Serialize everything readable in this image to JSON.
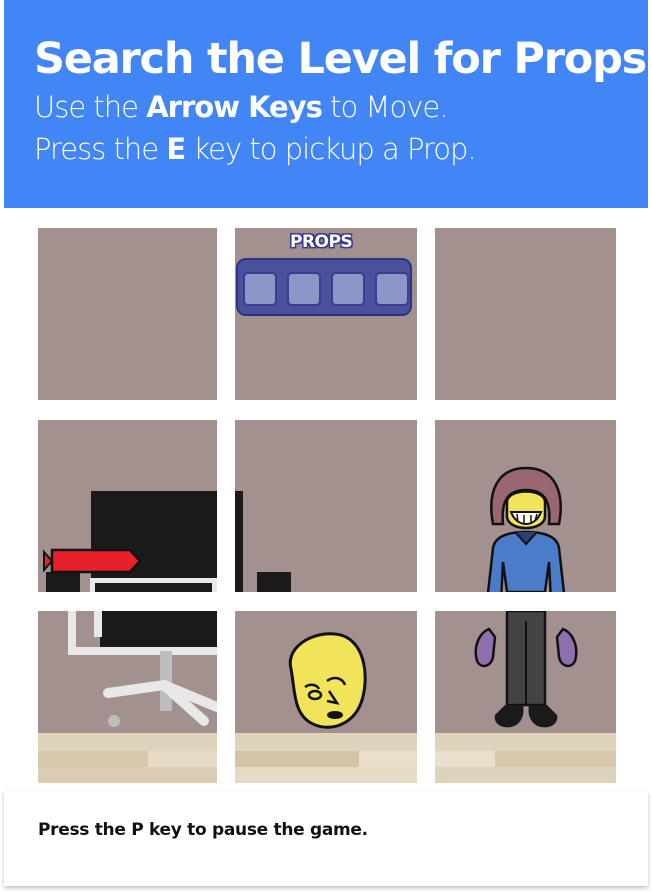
{
  "header": {
    "title": "Search the Level for Props.",
    "line1_pre": "Use the ",
    "line1_bold": "Arrow Keys",
    "line1_post": " to Move.",
    "line2_pre": "Press the ",
    "line2_bold": "E",
    "line2_post": " key to pickup a Prop."
  },
  "hud": {
    "props_label": "PROPS",
    "slots": [
      "empty",
      "empty",
      "empty",
      "empty"
    ]
  },
  "scene": {
    "objects": [
      "office-chair-icon",
      "red-bomb-icon",
      "yellow-mask-icon",
      "masked-character-icon"
    ]
  },
  "footer": {
    "instruction": "Press the P key to pause the game."
  },
  "colors": {
    "banner": "#4286f5",
    "tile": "#a39190",
    "floor": "#ddd0b9",
    "hud": "#4b509c"
  }
}
